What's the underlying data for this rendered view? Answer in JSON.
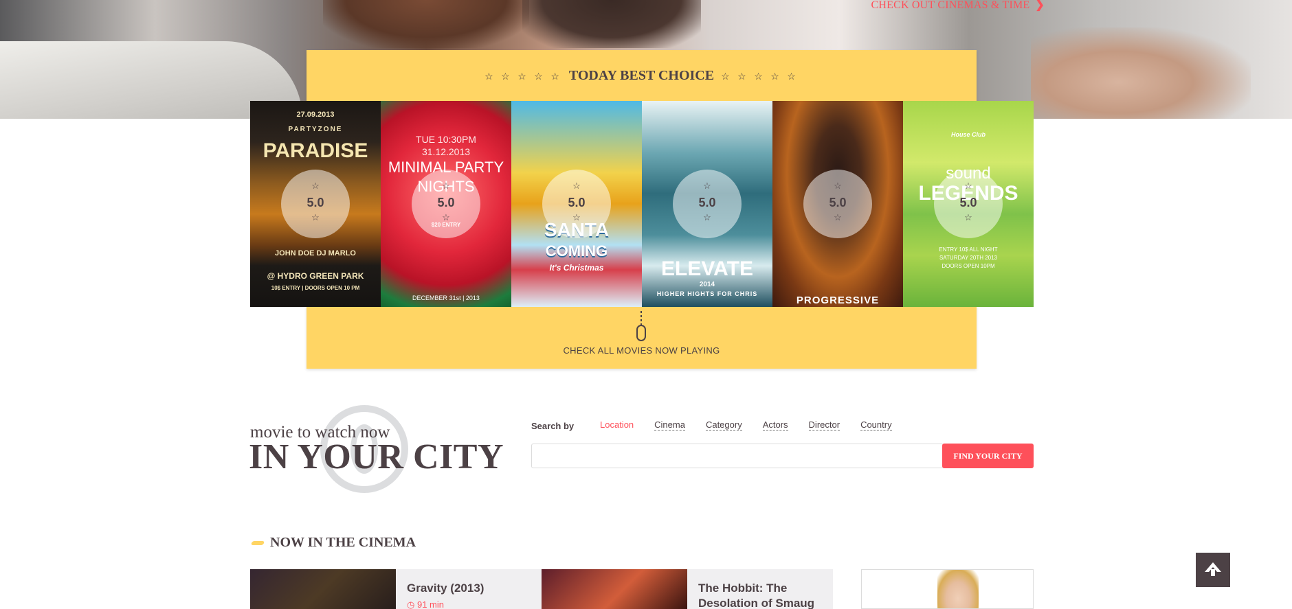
{
  "hero": {
    "link_label": "CHECK OUT CINEMAS & TIME"
  },
  "best_choice": {
    "stars_left": "☆ ☆ ☆ ☆ ☆",
    "title": "TODAY BEST CHOICE",
    "stars_right": "☆ ☆ ☆ ☆ ☆",
    "cta_label": "CHECK ALL MOVIES NOW PLAYING",
    "posters": [
      {
        "rating": "5.0",
        "lines": [
          "27.09.2013",
          "PARTYZONE",
          "PARADISE",
          "JOHN DOE  DJ MARLO",
          "@ HYDRO GREEN PARK",
          "10$ ENTRY | DOORS OPEN 10 PM"
        ]
      },
      {
        "rating": "5.0",
        "lines": [
          "TUE 10:30PM",
          "31.12.2013",
          "MINIMAL PARTY",
          "NIGHTS",
          "$20 ENTRY",
          "DECEMBER 31st | 2013"
        ]
      },
      {
        "rating": "5.0",
        "lines": [
          "SANTA",
          "COMING",
          "It's Christmas"
        ]
      },
      {
        "rating": "5.0",
        "lines": [
          "ELEVATE",
          "2014",
          "HIGHER HIGHTS FOR CHRIS"
        ]
      },
      {
        "rating": "5.0",
        "lines": [
          "PROGRESSIVE"
        ]
      },
      {
        "rating": "5.0",
        "lines": [
          "House Club",
          "sound",
          "LEGENDS",
          "ENTRY 10$ ALL NIGHT",
          "SATURDAY 20TH 2013",
          "DOORS OPEN 10PM"
        ]
      }
    ]
  },
  "search": {
    "subtitle": "movie to watch now",
    "title": "IN YOUR CITY",
    "searchby_label": "Search by",
    "filters": [
      "Location",
      "Cinema",
      "Category",
      "Actors",
      "Director",
      "Country"
    ],
    "active_filter": "Location",
    "input_value": "",
    "button_label": "FIND YOUR CITY"
  },
  "now_in_cinema": {
    "title": "NOW IN THE CINEMA",
    "movies": [
      {
        "title": "Gravity (2013)",
        "duration": "91 min"
      },
      {
        "title": "The Hobbit: The Desolation of Smaug",
        "duration": ""
      }
    ]
  },
  "colors": {
    "accent": "#fe505a",
    "yellow": "#ffd564",
    "text": "#4c4145"
  },
  "icons": {
    "to_top": "arrow-up-icon",
    "mouse": "mouse-scroll-icon",
    "clock": "clock-icon"
  }
}
